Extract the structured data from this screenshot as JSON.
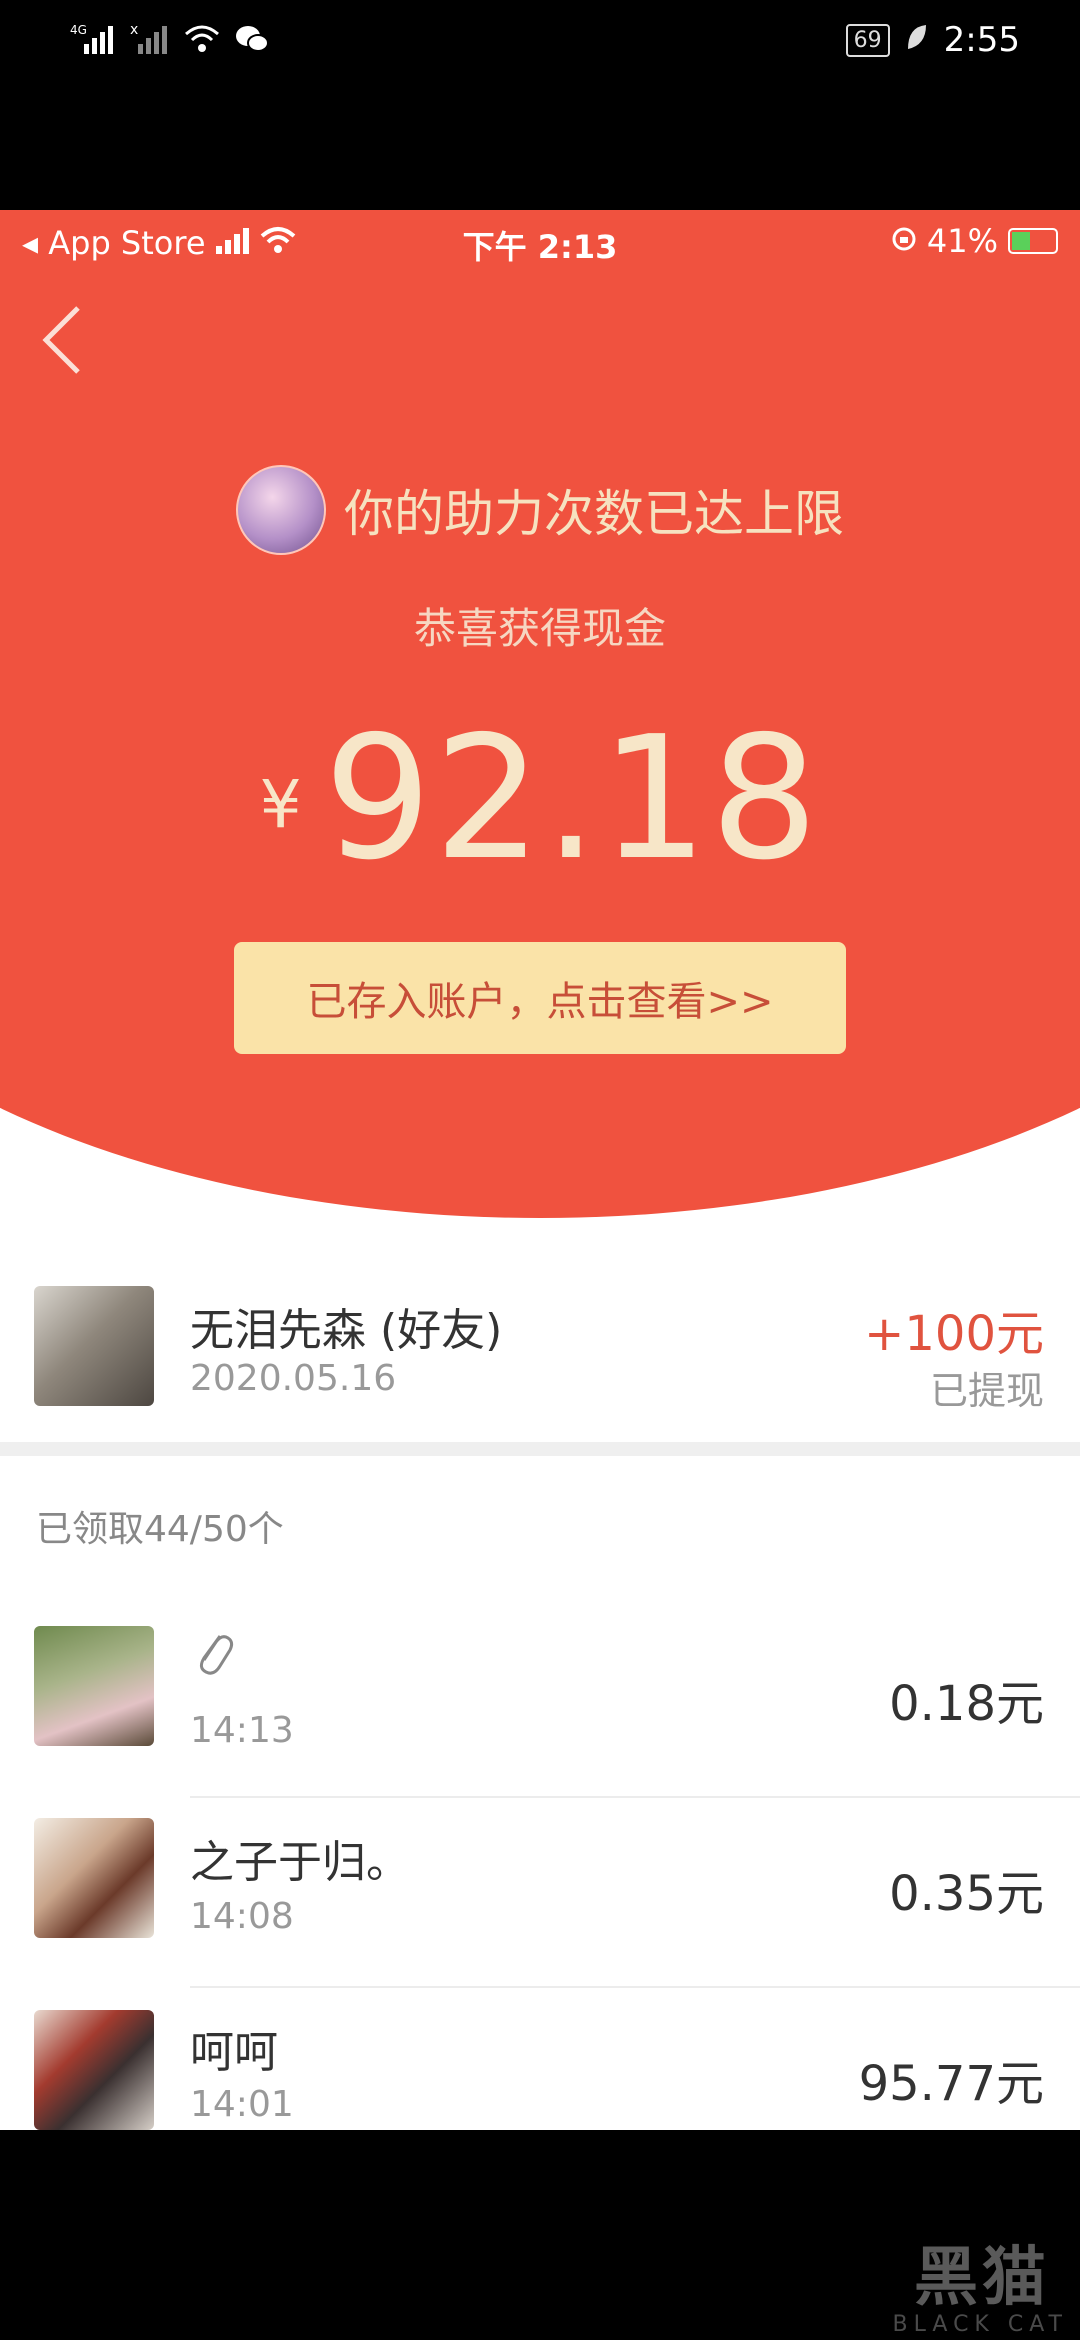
{
  "android_status": {
    "signal_1": "⁴ᴳ",
    "signal_2": "ˣ",
    "battery": "69",
    "time": "2:55"
  },
  "ios_status": {
    "carrier": "◂ App Store",
    "time": "下午 2:13",
    "battery_pct": "41%"
  },
  "header": {
    "title": "你的助力次数已达上限",
    "subtitle": "恭喜获得现金",
    "currency": "¥",
    "amount": "92.18",
    "deposit_button": "已存入账户，点击查看>>"
  },
  "friend": {
    "name": "无泪先森 (好友)",
    "date": "2020.05.16",
    "amount": "+100元",
    "status": "已提现"
  },
  "received": {
    "label": "已领取44/50个",
    "items": [
      {
        "name": "📎",
        "time": "14:13",
        "amount": "0.18元"
      },
      {
        "name": "之子于归。",
        "time": "14:08",
        "amount": "0.35元"
      },
      {
        "name": "呵呵",
        "time": "14:01",
        "amount": "95.77元"
      }
    ]
  },
  "watermark": {
    "text": "黑猫",
    "sub": "BLACK CAT"
  },
  "colors": {
    "header_red": "#f0523f",
    "button_yellow": "#fae3a8",
    "amount_red": "#e0533f"
  }
}
